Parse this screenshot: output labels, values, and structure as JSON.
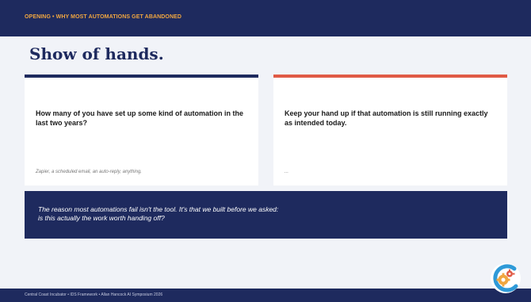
{
  "header": {
    "kicker": "OPENING • WHY MOST AUTOMATIONS GET ABANDONED"
  },
  "title": "Show of hands.",
  "cards": [
    {
      "question": "How many of you have set up some kind of automation in the last two years?",
      "note": "Zapier, a scheduled email, an auto-reply, anything."
    },
    {
      "question": "Keep your hand up if that automation is still running exactly as intended today.",
      "note": "..."
    }
  ],
  "quote": {
    "line1": "The reason most automations fail isn't the tool. It's that we built before we asked:",
    "line2": "is this actually the work worth handing off?"
  },
  "footer": {
    "text": "Central Coast Incubator • IDS Framework • Allan Hancock AI Symposium 2026"
  },
  "colors": {
    "navy": "#1e2a5e",
    "orange": "#f0a640",
    "red": "#e05a45",
    "logo_blue": "#2f9ad8"
  },
  "logo": {
    "icon": "gears-logo-icon"
  }
}
